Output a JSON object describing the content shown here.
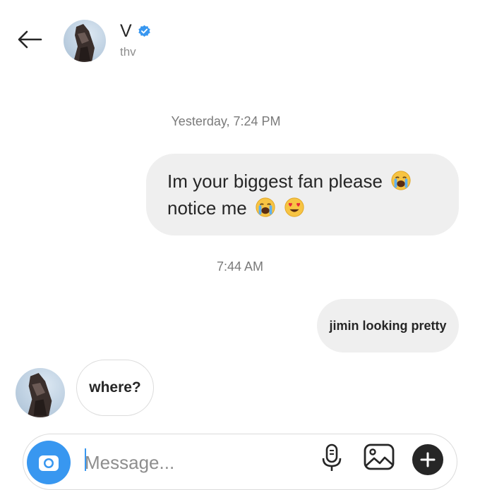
{
  "header": {
    "name": "V",
    "handle": "thv",
    "icons": {
      "back": "arrow-left-icon",
      "verified": "verified-badge-icon"
    },
    "colors": {
      "verified": "#3897f0"
    }
  },
  "thread": {
    "timestamp_1": "Yesterday, 7:24 PM",
    "message_1_line1": "Im your biggest fan please",
    "message_1_line2": "notice me",
    "timestamp_2": "7:44 AM",
    "message_2": "jimin looking pretty",
    "message_3": "where?",
    "emojis": [
      "loudly-crying-face-emoji",
      "loudly-crying-face-emoji",
      "heart-eyes-emoji"
    ]
  },
  "composer": {
    "placeholder": "Message...",
    "value": "",
    "icons": [
      "camera-icon",
      "microphone-icon",
      "image-icon",
      "plus-icon"
    ],
    "colors": {
      "camera_button": "#3897f0"
    }
  }
}
